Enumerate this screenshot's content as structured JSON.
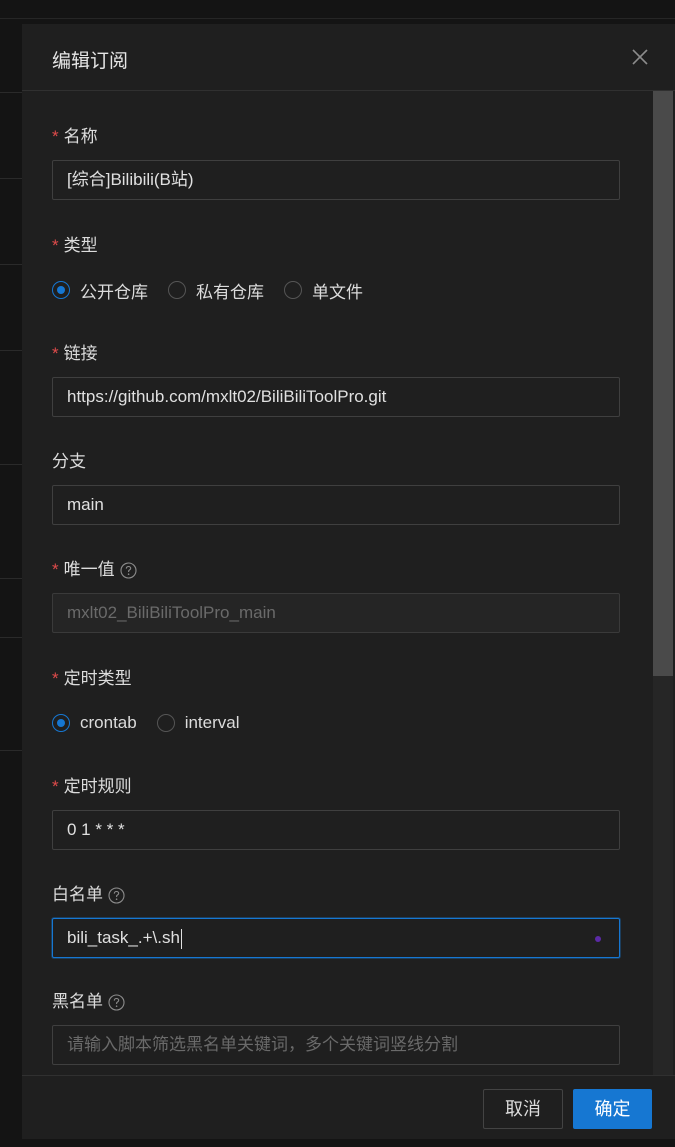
{
  "modal": {
    "title": "编辑订阅",
    "close_icon": "close-icon"
  },
  "form": {
    "name": {
      "label": "名称",
      "required": true,
      "value": "[综合]Bilibili(B站)"
    },
    "type": {
      "label": "类型",
      "required": true,
      "options": [
        "公开仓库",
        "私有仓库",
        "单文件"
      ],
      "selected": "公开仓库"
    },
    "url": {
      "label": "链接",
      "required": true,
      "value": "https://github.com/mxlt02/BiliBiliToolPro.git"
    },
    "branch": {
      "label": "分支",
      "required": false,
      "value": "main"
    },
    "alias": {
      "label": "唯一值",
      "required": true,
      "help_icon": "question-circle-icon",
      "value": "mxlt02_BiliBiliToolPro_main",
      "disabled": true
    },
    "schedule_type": {
      "label": "定时类型",
      "required": true,
      "options": [
        "crontab",
        "interval"
      ],
      "selected": "crontab"
    },
    "schedule": {
      "label": "定时规则",
      "required": true,
      "value": "0 1 * * *"
    },
    "whitelist": {
      "label": "白名单",
      "required": false,
      "help_icon": "question-circle-icon",
      "value": "bili_task_.+\\.sh"
    },
    "blacklist": {
      "label": "黑名单",
      "required": false,
      "help_icon": "question-circle-icon",
      "placeholder": "请输入脚本筛选黑名单关键词，多个关键词竖线分割"
    }
  },
  "footer": {
    "cancel_label": "取消",
    "ok_label": "确定"
  },
  "colors": {
    "primary": "#1677d2",
    "required": "#e04b4b",
    "background": "#1f1f1f"
  }
}
